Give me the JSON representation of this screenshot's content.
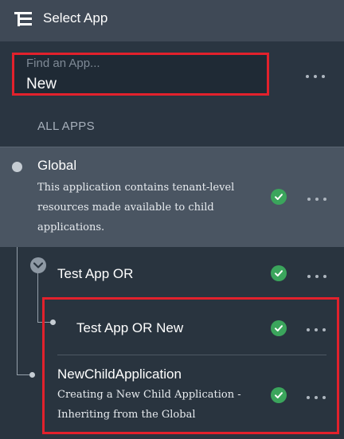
{
  "header": {
    "icon": "app-list-icon",
    "title": "Select App"
  },
  "search": {
    "placeholder": "Find an App...",
    "value": "New"
  },
  "section_label": "ALL APPS",
  "apps": {
    "global": {
      "name": "Global",
      "description": "This application contains tenant-level resources made available to child applications.",
      "status": "check-icon"
    },
    "test_app_or": {
      "name": "Test App OR",
      "status": "check-icon",
      "expand_icon": "chevron-down-icon"
    },
    "test_app_or_new": {
      "name": "Test App OR New",
      "status": "check-icon"
    },
    "new_child": {
      "name": "NewChildApplication",
      "description": "Creating a New Child Application - Inheriting from the Global",
      "status": "check-icon"
    }
  },
  "colors": {
    "header_bg": "#3f4956",
    "panel_bg": "#29343f",
    "selected_row_bg": "#4a5562",
    "highlight_border": "#e2212c",
    "status_green": "#3ba55c"
  }
}
